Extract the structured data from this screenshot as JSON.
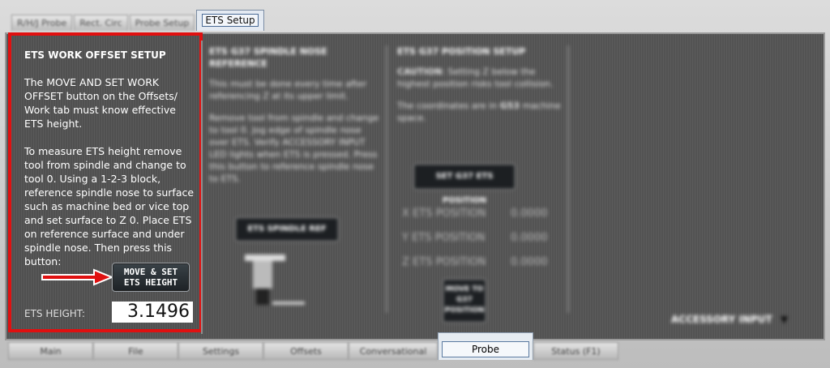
{
  "subtabs": [
    {
      "label": "R/H/J Probe"
    },
    {
      "label": "Rect. Circ"
    },
    {
      "label": "Probe Setup"
    },
    {
      "label": "ETS Setup"
    }
  ],
  "ets": {
    "title": "ETS WORK OFFSET SETUP",
    "para1": "The MOVE AND SET WORK OFFSET button on the Offsets/ Work tab must know effective ETS height.",
    "para2": "To measure ETS height remove tool from spindle and change to tool 0. Using a 1-2-3 block, reference spindle nose to surface such as machine bed or vice top and set surface to Z 0. Place ETS on reference surface and under spindle nose. Then press this button:",
    "button_line1": "MOVE & SET",
    "button_line2": "ETS HEIGHT",
    "height_label": "ETS HEIGHT:",
    "height_value": "3.1496"
  },
  "middle": {
    "title": "ETS G37 SPINDLE NOSE REFERENCE",
    "text1": "This must be done every time after referencing Z at its upper limit.",
    "text2": "Remove tool from spindle and change to tool 0. Jog edge of spindle nose over ETS. Verify ACCESSORY INPUT LED lights when ETS is pressed. Press this button to reference spindle nose to ETS.",
    "button": "ETS SPINDLE REF"
  },
  "right": {
    "title": "ETS G37 POSITION SETUP",
    "caution_label": "CAUTION",
    "caution": ": Setting Z below the highest position risks tool collision.",
    "coords_prefix": "The coordinates are in ",
    "coords_bold": "G53",
    "coords_suffix": " machine space.",
    "set_button": "SET G37 ETS POSITION",
    "rows": [
      {
        "label": "X ETS POSITION",
        "value": "0.0000"
      },
      {
        "label": "Y ETS POSITION",
        "value": "0.0000"
      },
      {
        "label": "Z ETS POSITION",
        "value": "0.0000"
      }
    ],
    "move_button": "MOVE TO G37 POSITION"
  },
  "accessory_label": "ACCESSORY INPUT",
  "bottom_tabs": [
    {
      "label": "Main"
    },
    {
      "label": "File"
    },
    {
      "label": "Settings"
    },
    {
      "label": "Offsets"
    },
    {
      "label": "Conversational"
    },
    {
      "label": "Probe"
    },
    {
      "label": "Status (F1)"
    }
  ],
  "colors": {
    "highlight_border": "#e01010",
    "arrow": "#e01010",
    "panel_bg": "#555555"
  }
}
